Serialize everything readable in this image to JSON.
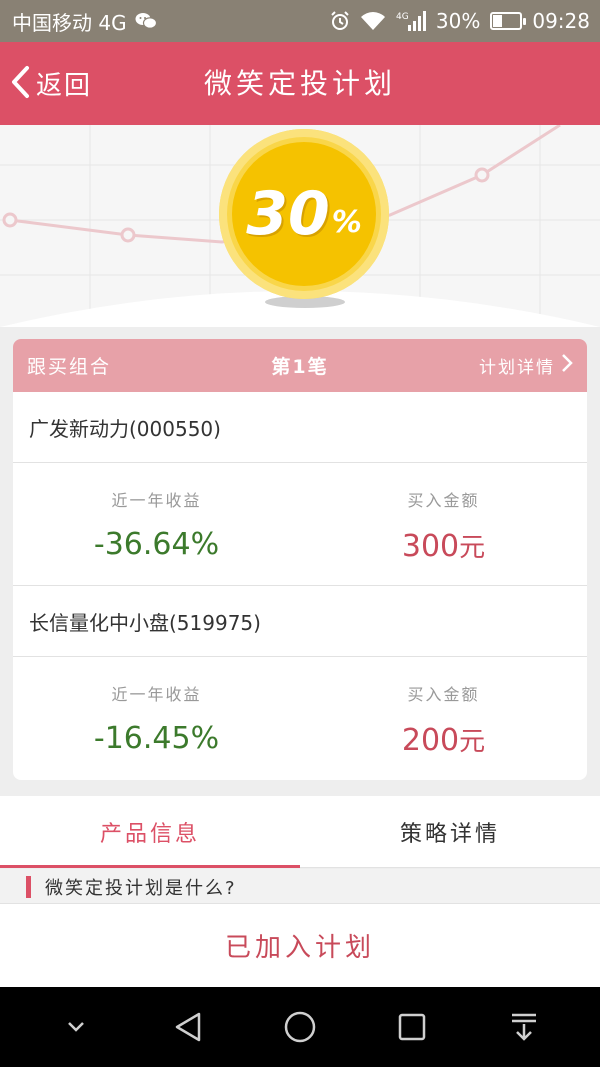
{
  "status_bar": {
    "carrier": "中国移动 4G",
    "battery_pct": "30%",
    "battery_level": 0.3,
    "time": "09:28",
    "icons": [
      "wechat-icon",
      "alarm-icon",
      "wifi-icon",
      "signal-4g-icon",
      "battery-icon"
    ]
  },
  "header": {
    "back_label": "返回",
    "title": "微笑定投计划"
  },
  "hero": {
    "percent_value": "30",
    "percent_sign": "%"
  },
  "card": {
    "header_left": "跟买组合",
    "header_mid": "第1笔",
    "header_right": "计划详情",
    "funds": [
      {
        "name": "广发新动力(000550)",
        "return_label": "近一年收益",
        "return_value": "-36.64%",
        "amount_label": "买入金额",
        "amount_value": "300",
        "amount_unit": "元"
      },
      {
        "name": "长信量化中小盘(519975)",
        "return_label": "近一年收益",
        "return_value": "-16.45%",
        "amount_label": "买入金额",
        "amount_value": "200",
        "amount_unit": "元"
      }
    ]
  },
  "tabs": [
    {
      "label": "产品信息",
      "active": true
    },
    {
      "label": "策略详情",
      "active": false
    }
  ],
  "section": {
    "question": "微笑定投计划是什么?"
  },
  "bottom_button": {
    "label": "已加入计划"
  },
  "colors": {
    "brand": "#dc5066",
    "card_header": "#e7a1a8",
    "negative_return": "#3c7a2c",
    "amount": "#c84a5a",
    "coin": "#f5c200"
  },
  "nav_icons": [
    "chevron-down-icon",
    "back-triangle-icon",
    "home-circle-icon",
    "recents-square-icon",
    "notification-pull-icon"
  ]
}
